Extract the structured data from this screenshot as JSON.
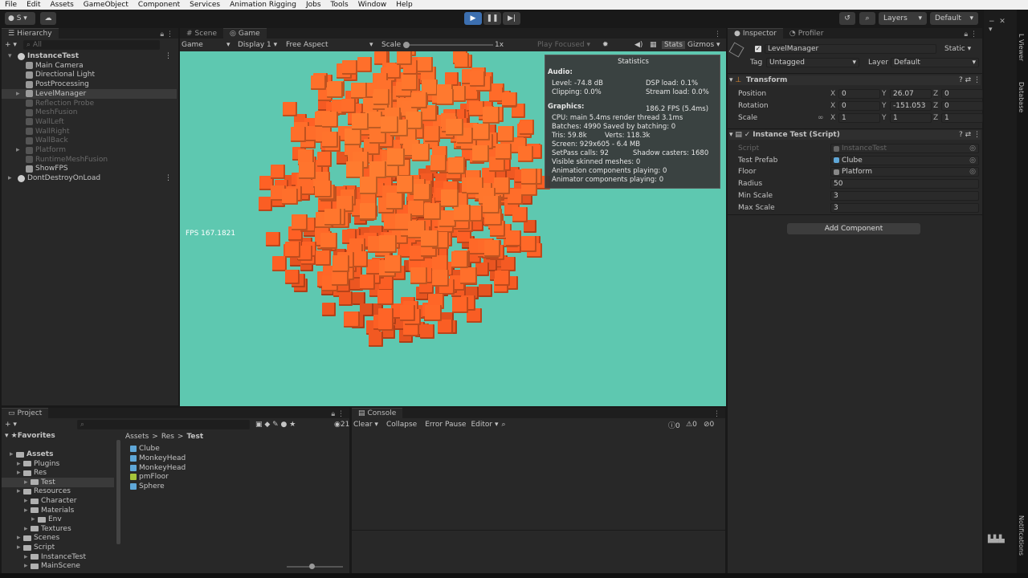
{
  "menu": [
    "File",
    "Edit",
    "Assets",
    "GameObject",
    "Component",
    "Services",
    "Animation Rigging",
    "Jobs",
    "Tools",
    "Window",
    "Help"
  ],
  "toolbar": {
    "account": "S",
    "layers": "Layers",
    "layout": "Default"
  },
  "hierarchy": {
    "tab": "Hierarchy",
    "search_placeholder": "All",
    "items": [
      {
        "label": "InstanceTest",
        "indent": 0,
        "disabled": false,
        "bold": true,
        "arrow": "▾"
      },
      {
        "label": "Main Camera",
        "indent": 1,
        "disabled": false,
        "bold": false,
        "arrow": ""
      },
      {
        "label": "Directional Light",
        "indent": 1,
        "disabled": false,
        "bold": false,
        "arrow": ""
      },
      {
        "label": "PostProcessing",
        "indent": 1,
        "disabled": false,
        "bold": false,
        "arrow": ""
      },
      {
        "label": "LevelManager",
        "indent": 1,
        "disabled": false,
        "bold": false,
        "arrow": "▸",
        "selected": true
      },
      {
        "label": "Reflection Probe",
        "indent": 1,
        "disabled": true,
        "bold": false,
        "arrow": ""
      },
      {
        "label": "MeshFusion",
        "indent": 1,
        "disabled": true,
        "bold": false,
        "arrow": ""
      },
      {
        "label": "WallLeft",
        "indent": 1,
        "disabled": true,
        "bold": false,
        "arrow": ""
      },
      {
        "label": "WallRight",
        "indent": 1,
        "disabled": true,
        "bold": false,
        "arrow": ""
      },
      {
        "label": "WallBack",
        "indent": 1,
        "disabled": true,
        "bold": false,
        "arrow": ""
      },
      {
        "label": "Platform",
        "indent": 1,
        "disabled": true,
        "bold": false,
        "arrow": "▸"
      },
      {
        "label": "RuntimeMeshFusion",
        "indent": 1,
        "disabled": true,
        "bold": false,
        "arrow": ""
      },
      {
        "label": "ShowFPS",
        "indent": 1,
        "disabled": false,
        "bold": false,
        "arrow": ""
      },
      {
        "label": "DontDestroyOnLoad",
        "indent": 0,
        "disabled": false,
        "bold": false,
        "arrow": "▸"
      }
    ]
  },
  "game": {
    "tabs": [
      "Scene",
      "Game"
    ],
    "mode": "Game",
    "display": "Display 1",
    "aspect": "Free Aspect",
    "scale_label": "Scale",
    "scale_value": "1x",
    "play_focused": "Play Focused",
    "stats": "Stats",
    "gizmos": "Gizmos",
    "fps": "FPS 167.1821",
    "bg_color": "#5ec8b0"
  },
  "statistics": {
    "title": "Statistics",
    "audio": "Audio:",
    "level": "Level: -74.8 dB",
    "dsp": "DSP load: 0.1%",
    "clipping": "Clipping: 0.0%",
    "stream": "Stream load: 0.0%",
    "graphics": "Graphics:",
    "fps": "186.2 FPS (5.4ms)",
    "cpu": "CPU: main 5.4ms  render thread 3.1ms",
    "batches": "Batches: 4990  Saved by batching: 0",
    "tris": "Tris: 59.8k",
    "verts": "Verts: 118.3k",
    "screen": "Screen: 929x605 - 6.4 MB",
    "setpass": "SetPass calls: 92",
    "shadow": "Shadow casters: 1680",
    "skinned": "Visible skinned meshes: 0",
    "anim": "Animation components playing: 0",
    "animator": "Animator components playing: 0"
  },
  "inspector": {
    "tabs": [
      "Inspector",
      "Profiler"
    ],
    "object_name": "LevelManager",
    "static": "Static",
    "tag_label": "Tag",
    "tag": "Untagged",
    "layer_label": "Layer",
    "layer": "Default",
    "transform": {
      "title": "Transform",
      "rows": [
        {
          "label": "Position",
          "x": "0",
          "y": "26.07",
          "z": "0"
        },
        {
          "label": "Rotation",
          "x": "0",
          "y": "-151.053",
          "z": "0"
        },
        {
          "label": "Scale",
          "x": "1",
          "y": "1",
          "z": "1"
        }
      ]
    },
    "script": {
      "title": "Instance Test (Script)",
      "rows": [
        {
          "label": "Script",
          "value": "InstanceTest",
          "dim": true,
          "kind": "script"
        },
        {
          "label": "Test Prefab",
          "value": "Clube",
          "dim": false,
          "kind": "prefab"
        },
        {
          "label": "Floor",
          "value": "Platform",
          "dim": false,
          "kind": "object"
        },
        {
          "label": "Radius",
          "value": "50",
          "dim": false,
          "kind": "num"
        },
        {
          "label": "Min Scale",
          "value": "3",
          "dim": false,
          "kind": "num"
        },
        {
          "label": "Max Scale",
          "value": "3",
          "dim": false,
          "kind": "num"
        }
      ]
    },
    "add_component": "Add Component"
  },
  "project": {
    "tab": "Project",
    "favorites": "Favorites",
    "breadcrumb": [
      "Assets",
      "Res",
      "Test"
    ],
    "badge": "21",
    "tree": [
      {
        "label": "Assets",
        "indent": 0,
        "bold": true
      },
      {
        "label": "Plugins",
        "indent": 1
      },
      {
        "label": "Res",
        "indent": 1
      },
      {
        "label": "Test",
        "indent": 2,
        "selected": true
      },
      {
        "label": "Resources",
        "indent": 1
      },
      {
        "label": "Character",
        "indent": 2
      },
      {
        "label": "Materials",
        "indent": 2
      },
      {
        "label": "Env",
        "indent": 3
      },
      {
        "label": "Textures",
        "indent": 2
      },
      {
        "label": "Scenes",
        "indent": 1
      },
      {
        "label": "Script",
        "indent": 1
      },
      {
        "label": "InstanceTest",
        "indent": 2
      },
      {
        "label": "MainScene",
        "indent": 2
      }
    ],
    "assets": [
      {
        "label": "Clube",
        "kind": "prefab"
      },
      {
        "label": "MonkeyHead",
        "kind": "prefab"
      },
      {
        "label": "MonkeyHead",
        "kind": "prefab"
      },
      {
        "label": "pmFloor",
        "kind": "material"
      },
      {
        "label": "Sphere",
        "kind": "prefab"
      }
    ]
  },
  "console": {
    "tab": "Console",
    "clear": "Clear",
    "collapse": "Collapse",
    "error_pause": "Error Pause",
    "editor": "Editor",
    "count_log": "0",
    "count_warn": "0",
    "count_err": "0"
  },
  "side": {
    "labels": [
      "L Viewer",
      "Database",
      "Notifications"
    ]
  }
}
